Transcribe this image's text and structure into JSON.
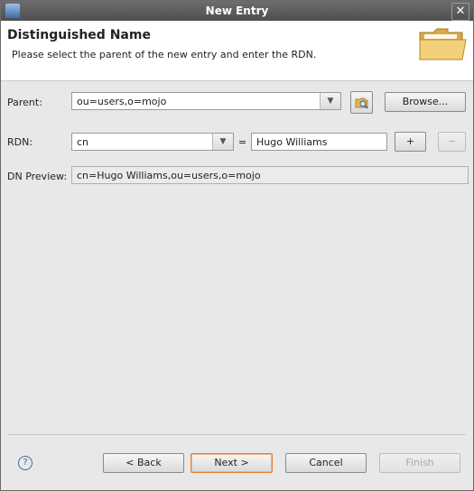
{
  "window": {
    "title": "New Entry"
  },
  "header": {
    "title": "Distinguished Name",
    "description": "Please select the parent of the new entry and enter the RDN."
  },
  "form": {
    "parent_label": "Parent:",
    "parent_value": "ou=users,o=mojo",
    "browse_label": "Browse...",
    "rdn_label": "RDN:",
    "rdn_attribute": "cn",
    "equals": "=",
    "rdn_value": "Hugo Williams",
    "add_label": "+",
    "remove_label": "−",
    "preview_label": "DN Preview:",
    "preview_value": "cn=Hugo Williams,ou=users,o=mojo"
  },
  "footer": {
    "help": "?",
    "back_label": "< Back",
    "next_label": "Next >",
    "cancel_label": "Cancel",
    "finish_label": "Finish"
  },
  "icons": {
    "dropdown": "chevron-down-icon",
    "folder": "folder-icon",
    "entry_browse": "entry-browse-icon"
  }
}
